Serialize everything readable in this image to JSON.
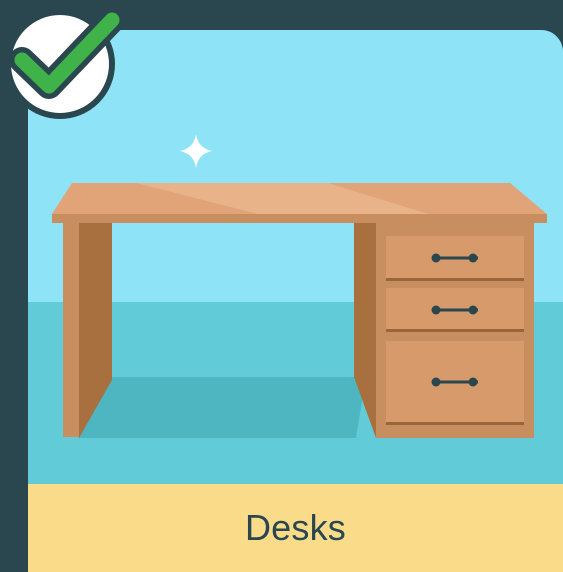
{
  "card": {
    "label": "Desks",
    "selected": true,
    "colors": {
      "frame": "#2a4750",
      "wall": "#8ee4f6",
      "floor": "#62cbd8",
      "label_bar": "#fadb8a",
      "check": "#3fb249"
    }
  },
  "icons": {
    "selected_badge": "check-icon",
    "sparkle": "sparkle-icon",
    "illustration": "desk-icon"
  }
}
